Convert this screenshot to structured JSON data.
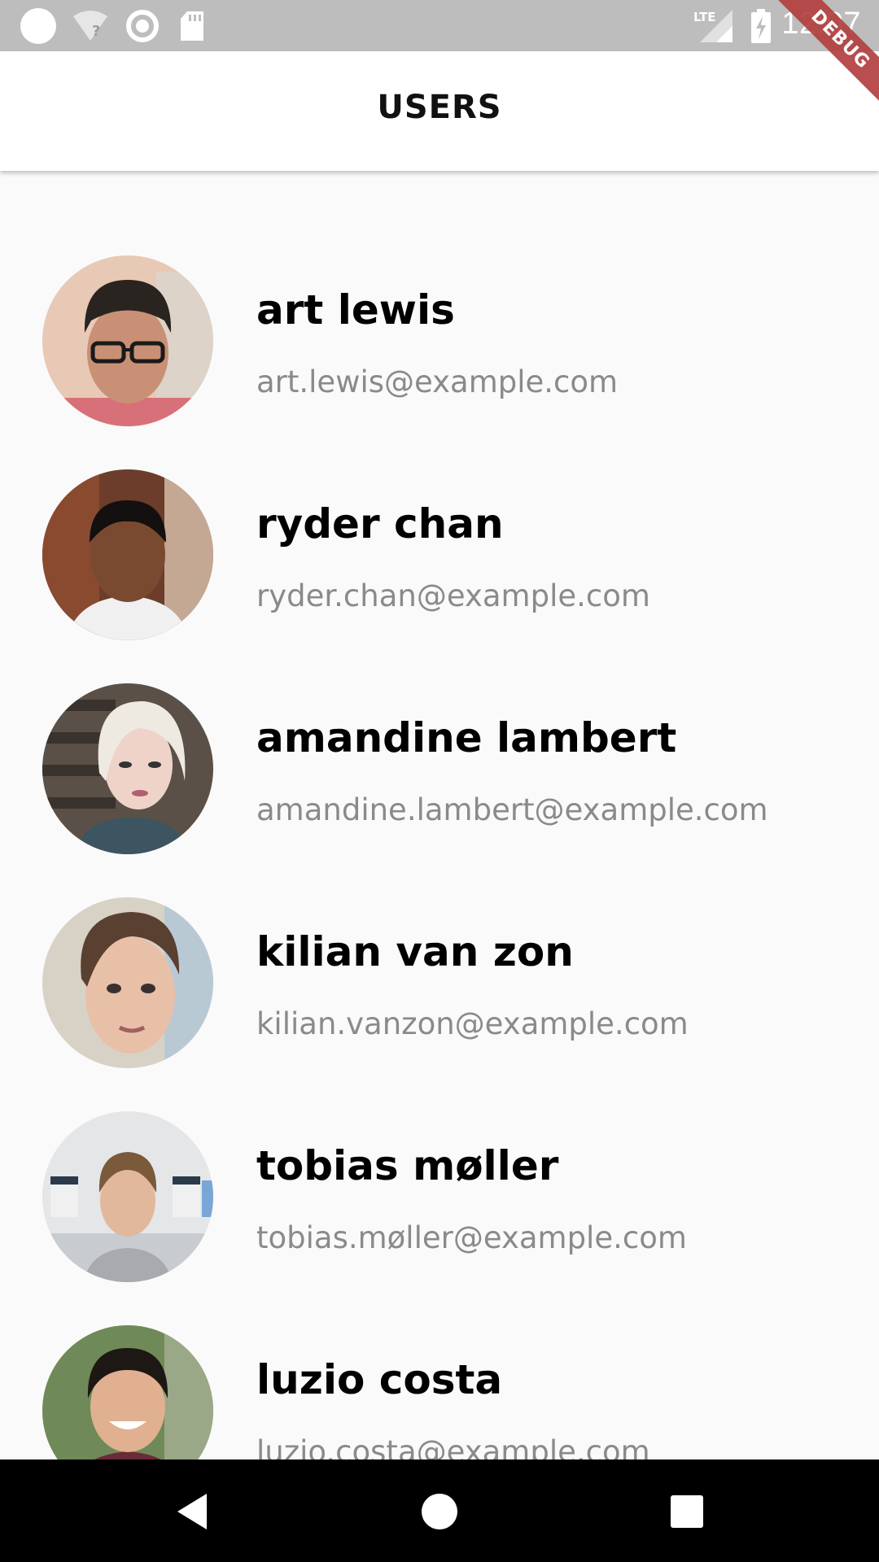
{
  "status_bar": {
    "time": "12:07",
    "network": "LTE",
    "icons": [
      "circle-icon",
      "wifi-unknown-icon",
      "sync-icon",
      "sd-card-icon",
      "lte-signal-icon",
      "battery-charging-icon"
    ]
  },
  "debug_banner": {
    "label": "DEBUG"
  },
  "app_bar": {
    "title": "USERS"
  },
  "users": [
    {
      "name": "art lewis",
      "email": "art.lewis@example.com"
    },
    {
      "name": "ryder chan",
      "email": "ryder.chan@example.com"
    },
    {
      "name": "amandine lambert",
      "email": "amandine.lambert@example.com"
    },
    {
      "name": "kilian van zon",
      "email": "kilian.vanzon@example.com"
    },
    {
      "name": "tobias møller",
      "email": "tobias.møller@example.com"
    },
    {
      "name": "luzio costa",
      "email": "luzio.costa@example.com"
    }
  ],
  "nav_bar": {
    "buttons": [
      "back-icon",
      "home-icon",
      "recents-icon"
    ]
  },
  "colors": {
    "status_bar": "#bdbdbd",
    "background": "#fafafa",
    "email_text": "#8a8a8a",
    "debug_ribbon": "#b3403f"
  }
}
